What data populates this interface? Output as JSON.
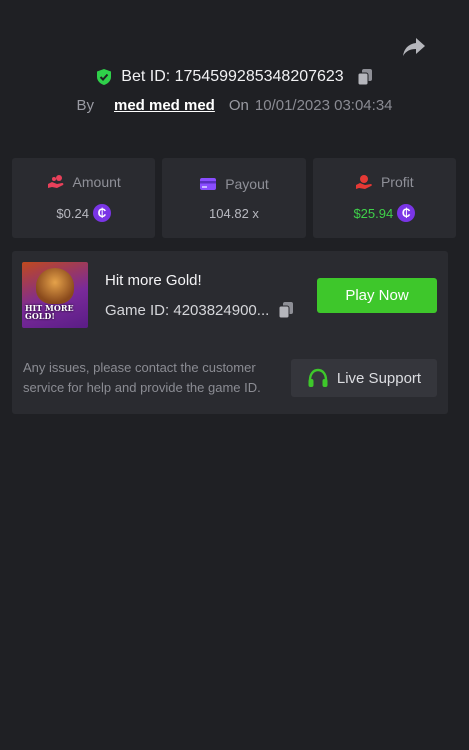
{
  "bet": {
    "id_label": "Bet ID: 1754599285348207623",
    "by_label": "By",
    "username": "med med med",
    "on_label": "On",
    "date": "10/01/2023 03:04:34"
  },
  "stats": [
    {
      "label": "Amount",
      "value": "$0.24",
      "icon": "hand-coins-icon",
      "color": "#e9405a",
      "coin": true
    },
    {
      "label": "Payout",
      "value": "104.82 x",
      "icon": "card-icon",
      "color": "#8a4dff",
      "coin": false
    },
    {
      "label": "Profit",
      "value": "$25.94",
      "icon": "hand-money-icon",
      "color": "#e53935",
      "coin": true
    }
  ],
  "coin_symbol": "₵",
  "game": {
    "title": "Hit more Gold!",
    "thumb_text": "HIT MORE GOLD!",
    "thumb_badge": "+",
    "id_label": "Game ID: 4203824900...",
    "play_label": "Play Now"
  },
  "support": {
    "text": "Any issues, please contact the customer service for help and provide the game ID.",
    "button_label": "Live Support"
  },
  "colors": {
    "background": "#1f2024",
    "card": "#2a2b30",
    "accent_green": "#3ec72b",
    "profit_green": "#3fd14a",
    "coin_purple": "#7a35e6"
  }
}
